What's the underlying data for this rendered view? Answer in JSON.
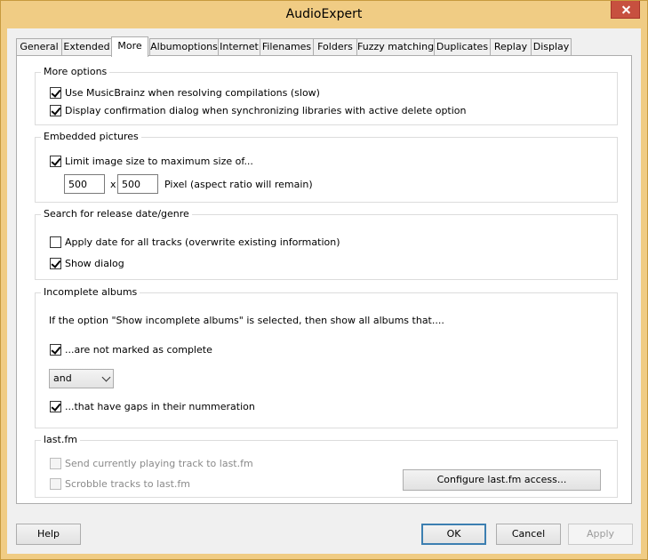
{
  "window": {
    "title": "AudioExpert"
  },
  "tabs": [
    {
      "label": "General"
    },
    {
      "label": "Extended"
    },
    {
      "label": "More"
    },
    {
      "label": "Albumoptions"
    },
    {
      "label": "Internet"
    },
    {
      "label": "Filenames"
    },
    {
      "label": "Folders"
    },
    {
      "label": "Fuzzy matching"
    },
    {
      "label": "Duplicates"
    },
    {
      "label": "Replay"
    },
    {
      "label": "Display"
    }
  ],
  "active_tab": "More",
  "more_options": {
    "title": "More options",
    "musicbrainz": {
      "label": "Use MusicBrainz when resolving compilations (slow)",
      "checked": true
    },
    "confirm_dialog": {
      "label": "Display confirmation dialog when synchronizing libraries with active delete option",
      "checked": true
    }
  },
  "embedded_pictures": {
    "title": "Embedded pictures",
    "limit_size": {
      "label": "Limit image size to maximum size of...",
      "checked": true
    },
    "width_value": "500",
    "x_label": "x",
    "height_value": "500",
    "pixel_note": "Pixel (aspect ratio will remain)"
  },
  "release_date": {
    "title": "Search for release date/genre",
    "apply_all": {
      "label": "Apply date for all tracks (overwrite existing information)",
      "checked": false
    },
    "show_dialog": {
      "label": "Show dialog",
      "checked": true
    }
  },
  "incomplete_albums": {
    "title": "Incomplete albums",
    "description": "If the option \"Show incomplete albums\" is selected, then show all albums that....",
    "not_complete": {
      "label": "...are not marked as complete",
      "checked": true
    },
    "operator_value": "and",
    "gaps": {
      "label": "...that have gaps in their nummeration",
      "checked": true
    }
  },
  "lastfm": {
    "title": "last.fm",
    "send_playing": {
      "label": "Send currently playing track to last.fm",
      "checked": false,
      "enabled": false
    },
    "scrobble": {
      "label": "Scrobble tracks to last.fm",
      "checked": false,
      "enabled": false
    },
    "configure_label": "Configure last.fm access..."
  },
  "buttons": {
    "help": "Help",
    "ok": "OK",
    "cancel": "Cancel",
    "apply": "Apply"
  }
}
